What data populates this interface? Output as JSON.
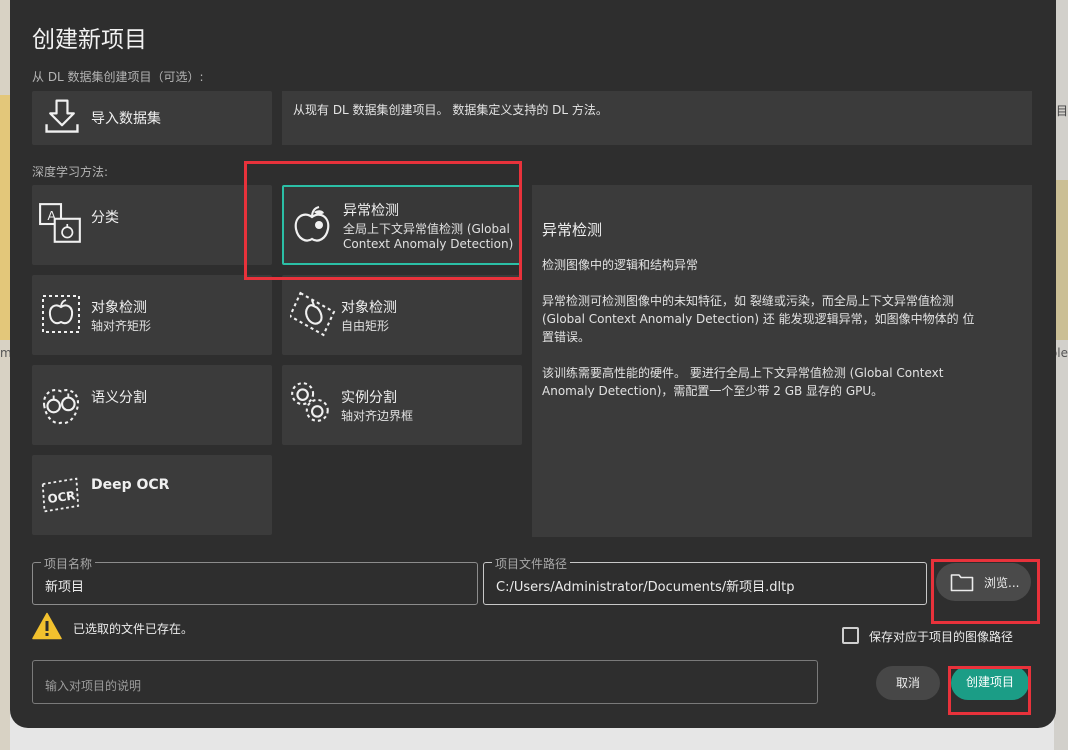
{
  "background": {
    "right_label_top": "目",
    "right_label_mid": "ple",
    "left_label_mid": "m"
  },
  "dialog": {
    "title": "创建新项目",
    "import_section_label": "从 DL 数据集创建项目（可选）:",
    "import_button_label": "导入数据集",
    "import_description": "从现有 DL 数据集创建项目。 数据集定义支持的 DL 方法。",
    "methods_section_label": "深度学习方法:",
    "methods": [
      {
        "title": "分类",
        "subtitle": "",
        "icon": "classification-icon"
      },
      {
        "title": "异常检测",
        "subtitle": "全局上下文异常值检测 (Global",
        "subtitle2": "Context Anomaly Detection)",
        "icon": "anomaly-apple-icon",
        "selected": true
      },
      {
        "title": "对象检测",
        "subtitle": "轴对齐矩形",
        "icon": "object-detection-axis-icon"
      },
      {
        "title": "对象检测",
        "subtitle": "自由矩形",
        "icon": "object-detection-free-icon"
      },
      {
        "title": "语义分割",
        "subtitle": "",
        "icon": "semantic-segmentation-icon"
      },
      {
        "title": "实例分割",
        "subtitle": "轴对齐边界框",
        "icon": "instance-segmentation-icon"
      },
      {
        "title": "Deep OCR",
        "subtitle": "",
        "icon": "ocr-icon"
      }
    ],
    "description_panel": {
      "title": "异常检测",
      "p1": "检测图像中的逻辑和结构异常",
      "p2": "异常检测可检测图像中的未知特征，如 裂缝或污染，而全局上下文异常值检测\n(Global Context Anomaly Detection) 还 能发现逻辑异常，如图像中物体的 位\n置错误。",
      "p3": "该训练需要高性能的硬件。 要进行全局上下文异常值检测 (Global Context\nAnomaly Detection)，需配置一个至少带 2 GB 显存的 GPU。"
    },
    "project_name": {
      "legend": "项目名称",
      "value": "新项目"
    },
    "project_path": {
      "legend": "项目文件路径",
      "value": "C:/Users/Administrator/Documents/新项目.dltp"
    },
    "browse_label": "浏览...",
    "warning_text": "已选取的文件已存在。",
    "save_relative_label": "保存对应于项目的图像路径",
    "save_relative_checked": false,
    "description_placeholder": "输入对项目的说明",
    "cancel_label": "取消",
    "create_label": "创建项目"
  },
  "colors": {
    "accent": "#1b9d86",
    "selection_border": "#2bbfa6",
    "highlight_box": "#e8323b",
    "warning": "#f2c12e"
  }
}
